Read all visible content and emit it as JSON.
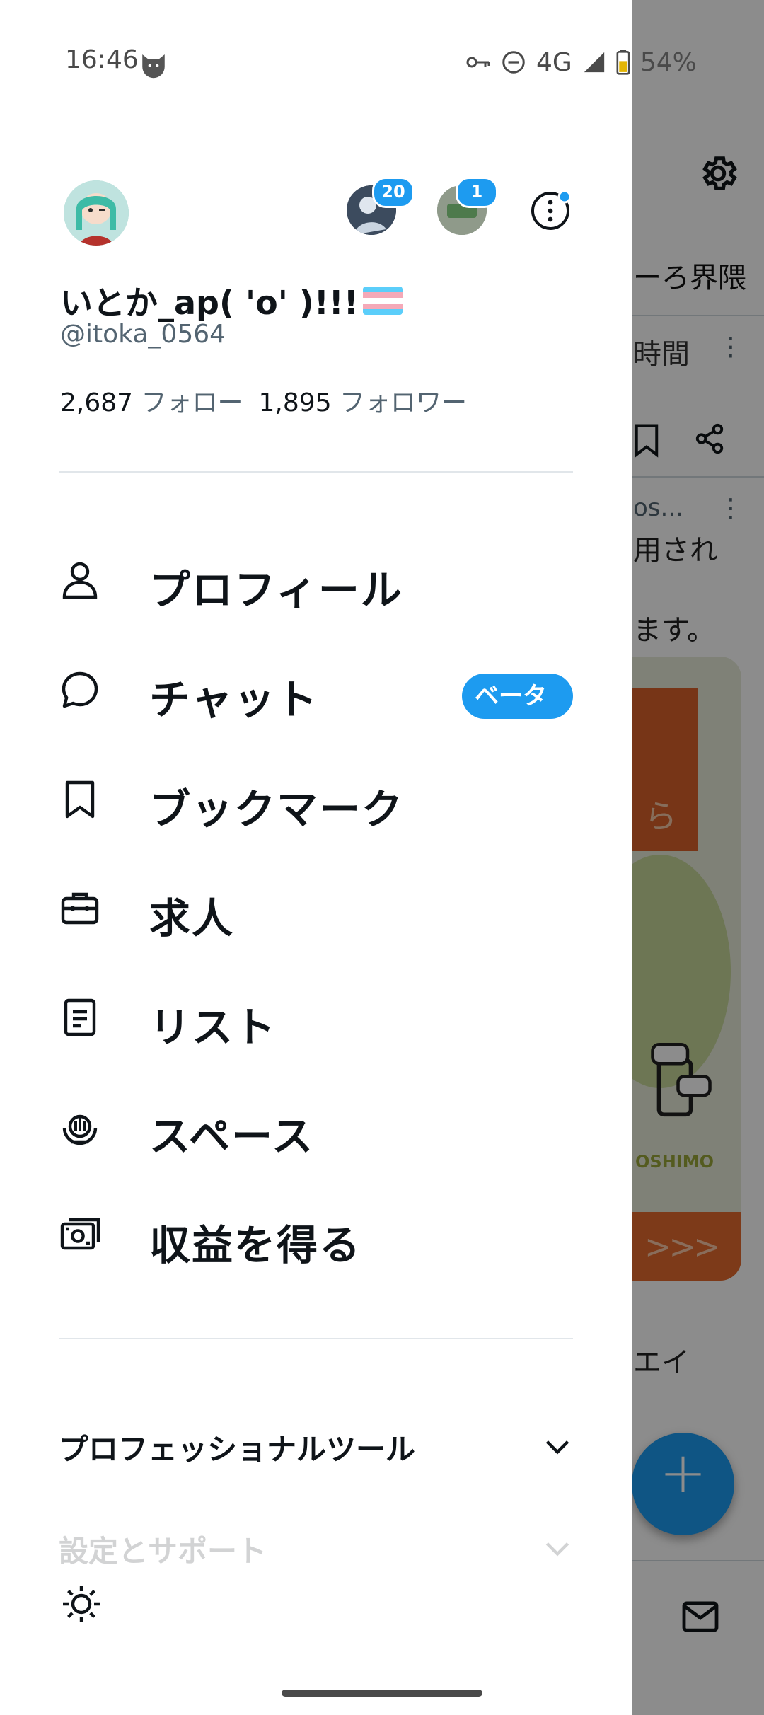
{
  "status_bar": {
    "time": "16:46",
    "network": "4G",
    "battery": "54%",
    "icons": [
      "cat-notification-icon",
      "vpn-key-icon",
      "do-not-disturb-icon",
      "signal-icon",
      "battery-icon"
    ]
  },
  "background": {
    "tab_label": "ーろ界隈",
    "time_label": "時間",
    "post_header": "os...",
    "post_line1": "用され",
    "post_line2": "ます。",
    "card_orange_text": "ら",
    "card_brand": "OSHIMO",
    "card_banner": ">>>",
    "post_footer": "エイ",
    "fab_label": "+",
    "colors": {
      "accent": "#1d9bf0",
      "card_orange": "#e46b2e",
      "card_green": "#c6d79a"
    }
  },
  "profile": {
    "display_name": "いとか_ap( 'o' )!!!",
    "handle": "@itoka_0564",
    "following_count": "2,687",
    "following_label": "フォロー",
    "followers_count": "1,895",
    "followers_label": "フォロワー",
    "accounts": [
      {
        "badge": "20"
      },
      {
        "badge": "1"
      }
    ]
  },
  "menu": {
    "items": [
      {
        "label": "プロフィール",
        "icon": "person-icon"
      },
      {
        "label": "チャット",
        "icon": "chat-bubble-icon",
        "badge": "ベータ版"
      },
      {
        "label": "ブックマーク",
        "icon": "bookmark-icon"
      },
      {
        "label": "求人",
        "icon": "briefcase-icon"
      },
      {
        "label": "リスト",
        "icon": "list-document-icon"
      },
      {
        "label": "スペース",
        "icon": "spaces-mic-icon"
      },
      {
        "label": "収益を得る",
        "icon": "money-icon"
      }
    ]
  },
  "sections": {
    "professional_tools": "プロフェッショナルツール",
    "settings_support": "設定とサポート"
  }
}
